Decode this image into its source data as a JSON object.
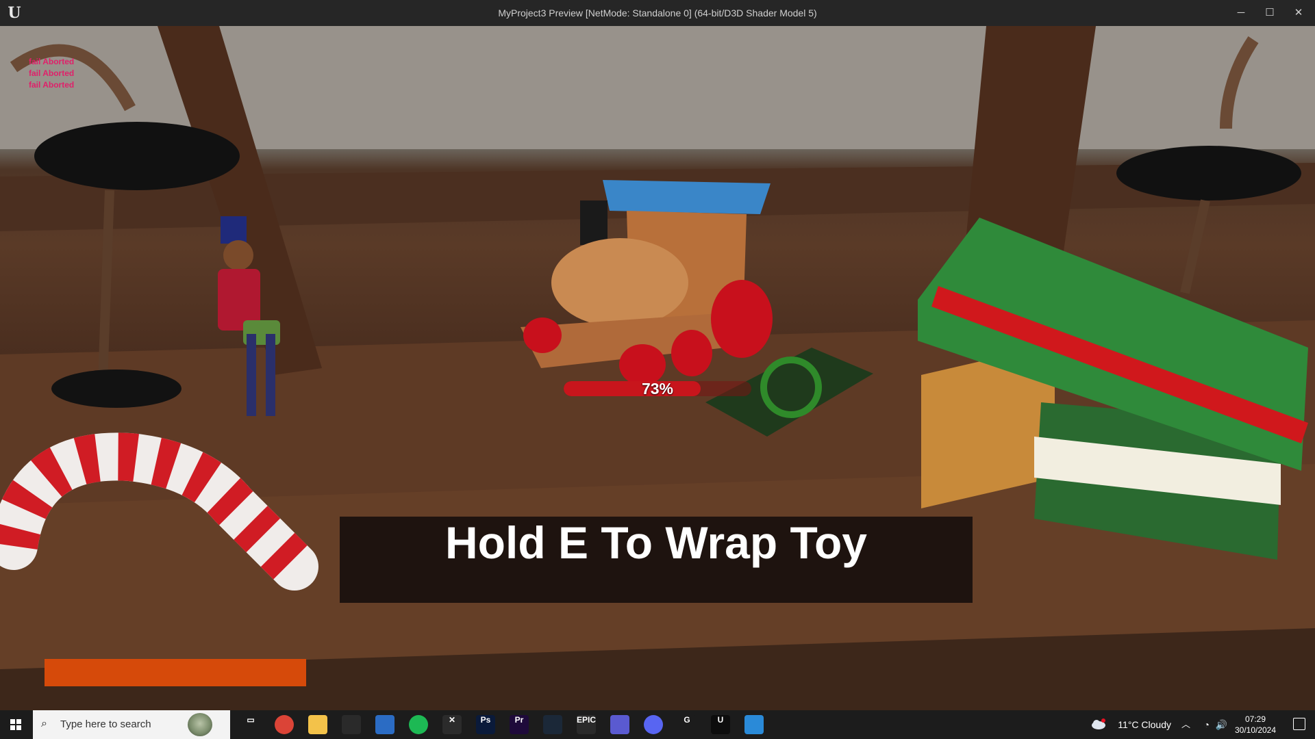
{
  "window": {
    "title": "MyProject3 Preview [NetMode: Standalone 0]  (64-bit/D3D Shader Model 5)",
    "logo_icon": "unreal-engine-icon",
    "controls": {
      "minimize": "─",
      "maximize": "☐",
      "close": "✕"
    }
  },
  "game": {
    "debug_log": [
      "fail Aborted",
      "fail Aborted",
      "fail Aborted"
    ],
    "wrap_progress": {
      "percent": 73,
      "label": "73%"
    },
    "prompt": "Hold E To Wrap Toy",
    "stamina_bar": {
      "fill_percent": 100,
      "color": "#d64a0a"
    }
  },
  "taskbar": {
    "search_placeholder": "Type here to search",
    "pinned": [
      {
        "name": "task-view-icon",
        "glyph": "▭"
      },
      {
        "name": "chrome-icon",
        "glyph": ""
      },
      {
        "name": "file-explorer-icon",
        "glyph": ""
      },
      {
        "name": "davinci-icon",
        "glyph": ""
      },
      {
        "name": "store-icon",
        "glyph": ""
      },
      {
        "name": "spotify-icon",
        "glyph": ""
      },
      {
        "name": "excel-icon",
        "glyph": "✕"
      },
      {
        "name": "photoshop-icon",
        "glyph": "Ps"
      },
      {
        "name": "premiere-icon",
        "glyph": "Pr"
      },
      {
        "name": "steam-icon",
        "glyph": ""
      },
      {
        "name": "epic-games-icon",
        "glyph": "EPIC"
      },
      {
        "name": "calendar-app-icon",
        "glyph": ""
      },
      {
        "name": "discord-icon",
        "glyph": ""
      },
      {
        "name": "logitech-g-icon",
        "glyph": "G"
      },
      {
        "name": "unreal-engine-icon",
        "glyph": "U"
      },
      {
        "name": "photos-icon",
        "glyph": ""
      }
    ],
    "weather": "11°C  Cloudy",
    "time": "07:29",
    "date": "30/10/2024",
    "colors": {
      "accent": "#c8151c",
      "prompt_bg": "#140e0c",
      "debug_text": "#e0206a"
    }
  }
}
